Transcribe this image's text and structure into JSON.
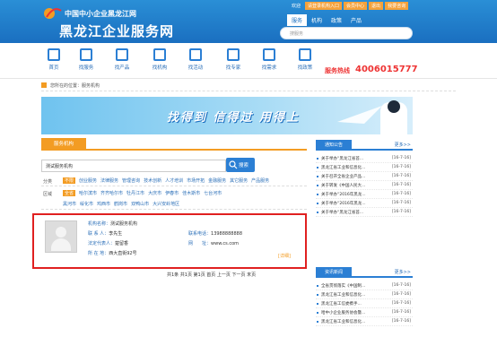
{
  "header": {
    "logo_text": "中国中小企业黑龙江网",
    "site_name": "黑龙江企业服务网",
    "toplinks": [
      "欢迎",
      "请登录机构入口",
      "会员中心",
      "退出",
      "我要咨询"
    ],
    "tabs": [
      "服务",
      "机构",
      "政策",
      "产品"
    ],
    "search_placeholder": "搜服务"
  },
  "nav": {
    "items": [
      "首页",
      "找服务",
      "找产品",
      "找机构",
      "找活动",
      "找专家",
      "找需求",
      "找政策"
    ],
    "hotline_label": "服务热线",
    "hotline_number": "4006015777"
  },
  "breadcrumb": {
    "text": "您所在的位置：服务机构"
  },
  "banner": {
    "slogan": "找得到 信得过 用得上"
  },
  "main": {
    "tab_label": "服务机构",
    "filter_value": "测试服务机构",
    "search_button": "搜索",
    "category_label": "分类",
    "categories": [
      "不限",
      "创业服务",
      "法律服务",
      "管理咨询",
      "技术创新",
      "人才培训",
      "市场开拓",
      "金融服务",
      "其它服务",
      "产品服务"
    ],
    "region_label": "区域",
    "regions_row1": [
      "全省",
      "哈尔滨市",
      "齐齐哈尔市",
      "牡丹江市",
      "大庆市",
      "伊春市",
      "佳木斯市",
      "七台河市"
    ],
    "regions_row2": [
      "黑河市",
      "绥化市",
      "鸡西市",
      "鹤岗市",
      "双鸭山市",
      "大兴安岭地区"
    ],
    "result": {
      "name_label": "机构名称：",
      "name": "测试服务机构",
      "contact_label": "联 系 人：",
      "contact": "李先生",
      "phone_label": "联系电话：",
      "phone": "13988888888",
      "legal_label": "法定代表人：",
      "legal": "楚留香",
      "site_label": "网　　址：",
      "site": "www.cs.com",
      "addr_label": "所 在 地：",
      "addr": "西大直街92号",
      "detail": "[详细]"
    },
    "pager": "共1条 共1页 第1页 首页 上一页 下一页 末页"
  },
  "sidebar": {
    "notice_title": "通知公告",
    "more": "更多>>",
    "notices": [
      {
        "t": "关于举办“黑龙江省首...",
        "d": "[16-7-16]"
      },
      {
        "t": "黑龙江省工业和信息化...",
        "d": "[16-7-16]"
      },
      {
        "t": "关于召开全省企业产品...",
        "d": "[16-7-16]"
      },
      {
        "t": "关于转发《中国人民大...",
        "d": "[16-7-16]"
      },
      {
        "t": "关于举办“2016年黑龙...",
        "d": "[16-7-16]"
      },
      {
        "t": "关于举办“2016年黑龙...",
        "d": "[16-7-16]"
      },
      {
        "t": "关于举办“黑龙江省首...",
        "d": "[16-7-16]"
      }
    ],
    "news_title": "资讯新闻",
    "news": [
      {
        "t": "全省贯彻落实《中国制...",
        "d": "[16-7-16]"
      },
      {
        "t": "黑龙江省工业和信息化...",
        "d": "[16-7-16]"
      },
      {
        "t": "黑龙江省工信委携手...",
        "d": "[16-7-16]"
      },
      {
        "t": "哈中小企业服务协会暨...",
        "d": "[16-7-16]"
      },
      {
        "t": "黑龙江省工业和信息化...",
        "d": "[16-7-16]"
      }
    ]
  },
  "colors": {
    "brand_blue": "#1a6fc0",
    "accent_orange": "#f39c23",
    "highlight_red": "#e02020"
  }
}
